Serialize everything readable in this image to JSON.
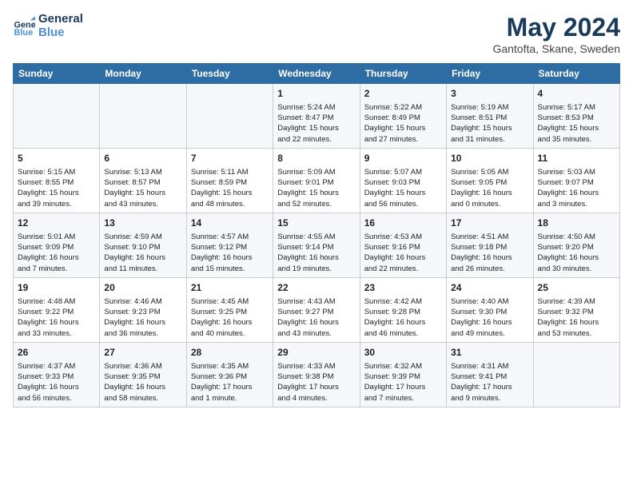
{
  "logo": {
    "line1": "General",
    "line2": "Blue"
  },
  "title": "May 2024",
  "subtitle": "Gantofta, Skane, Sweden",
  "weekdays": [
    "Sunday",
    "Monday",
    "Tuesday",
    "Wednesday",
    "Thursday",
    "Friday",
    "Saturday"
  ],
  "weeks": [
    [
      {
        "day": "",
        "content": ""
      },
      {
        "day": "",
        "content": ""
      },
      {
        "day": "",
        "content": ""
      },
      {
        "day": "1",
        "content": "Sunrise: 5:24 AM\nSunset: 8:47 PM\nDaylight: 15 hours\nand 22 minutes."
      },
      {
        "day": "2",
        "content": "Sunrise: 5:22 AM\nSunset: 8:49 PM\nDaylight: 15 hours\nand 27 minutes."
      },
      {
        "day": "3",
        "content": "Sunrise: 5:19 AM\nSunset: 8:51 PM\nDaylight: 15 hours\nand 31 minutes."
      },
      {
        "day": "4",
        "content": "Sunrise: 5:17 AM\nSunset: 8:53 PM\nDaylight: 15 hours\nand 35 minutes."
      }
    ],
    [
      {
        "day": "5",
        "content": "Sunrise: 5:15 AM\nSunset: 8:55 PM\nDaylight: 15 hours\nand 39 minutes."
      },
      {
        "day": "6",
        "content": "Sunrise: 5:13 AM\nSunset: 8:57 PM\nDaylight: 15 hours\nand 43 minutes."
      },
      {
        "day": "7",
        "content": "Sunrise: 5:11 AM\nSunset: 8:59 PM\nDaylight: 15 hours\nand 48 minutes."
      },
      {
        "day": "8",
        "content": "Sunrise: 5:09 AM\nSunset: 9:01 PM\nDaylight: 15 hours\nand 52 minutes."
      },
      {
        "day": "9",
        "content": "Sunrise: 5:07 AM\nSunset: 9:03 PM\nDaylight: 15 hours\nand 56 minutes."
      },
      {
        "day": "10",
        "content": "Sunrise: 5:05 AM\nSunset: 9:05 PM\nDaylight: 16 hours\nand 0 minutes."
      },
      {
        "day": "11",
        "content": "Sunrise: 5:03 AM\nSunset: 9:07 PM\nDaylight: 16 hours\nand 3 minutes."
      }
    ],
    [
      {
        "day": "12",
        "content": "Sunrise: 5:01 AM\nSunset: 9:09 PM\nDaylight: 16 hours\nand 7 minutes."
      },
      {
        "day": "13",
        "content": "Sunrise: 4:59 AM\nSunset: 9:10 PM\nDaylight: 16 hours\nand 11 minutes."
      },
      {
        "day": "14",
        "content": "Sunrise: 4:57 AM\nSunset: 9:12 PM\nDaylight: 16 hours\nand 15 minutes."
      },
      {
        "day": "15",
        "content": "Sunrise: 4:55 AM\nSunset: 9:14 PM\nDaylight: 16 hours\nand 19 minutes."
      },
      {
        "day": "16",
        "content": "Sunrise: 4:53 AM\nSunset: 9:16 PM\nDaylight: 16 hours\nand 22 minutes."
      },
      {
        "day": "17",
        "content": "Sunrise: 4:51 AM\nSunset: 9:18 PM\nDaylight: 16 hours\nand 26 minutes."
      },
      {
        "day": "18",
        "content": "Sunrise: 4:50 AM\nSunset: 9:20 PM\nDaylight: 16 hours\nand 30 minutes."
      }
    ],
    [
      {
        "day": "19",
        "content": "Sunrise: 4:48 AM\nSunset: 9:22 PM\nDaylight: 16 hours\nand 33 minutes."
      },
      {
        "day": "20",
        "content": "Sunrise: 4:46 AM\nSunset: 9:23 PM\nDaylight: 16 hours\nand 36 minutes."
      },
      {
        "day": "21",
        "content": "Sunrise: 4:45 AM\nSunset: 9:25 PM\nDaylight: 16 hours\nand 40 minutes."
      },
      {
        "day": "22",
        "content": "Sunrise: 4:43 AM\nSunset: 9:27 PM\nDaylight: 16 hours\nand 43 minutes."
      },
      {
        "day": "23",
        "content": "Sunrise: 4:42 AM\nSunset: 9:28 PM\nDaylight: 16 hours\nand 46 minutes."
      },
      {
        "day": "24",
        "content": "Sunrise: 4:40 AM\nSunset: 9:30 PM\nDaylight: 16 hours\nand 49 minutes."
      },
      {
        "day": "25",
        "content": "Sunrise: 4:39 AM\nSunset: 9:32 PM\nDaylight: 16 hours\nand 53 minutes."
      }
    ],
    [
      {
        "day": "26",
        "content": "Sunrise: 4:37 AM\nSunset: 9:33 PM\nDaylight: 16 hours\nand 56 minutes."
      },
      {
        "day": "27",
        "content": "Sunrise: 4:36 AM\nSunset: 9:35 PM\nDaylight: 16 hours\nand 58 minutes."
      },
      {
        "day": "28",
        "content": "Sunrise: 4:35 AM\nSunset: 9:36 PM\nDaylight: 17 hours\nand 1 minute."
      },
      {
        "day": "29",
        "content": "Sunrise: 4:33 AM\nSunset: 9:38 PM\nDaylight: 17 hours\nand 4 minutes."
      },
      {
        "day": "30",
        "content": "Sunrise: 4:32 AM\nSunset: 9:39 PM\nDaylight: 17 hours\nand 7 minutes."
      },
      {
        "day": "31",
        "content": "Sunrise: 4:31 AM\nSunset: 9:41 PM\nDaylight: 17 hours\nand 9 minutes."
      },
      {
        "day": "",
        "content": ""
      }
    ]
  ]
}
